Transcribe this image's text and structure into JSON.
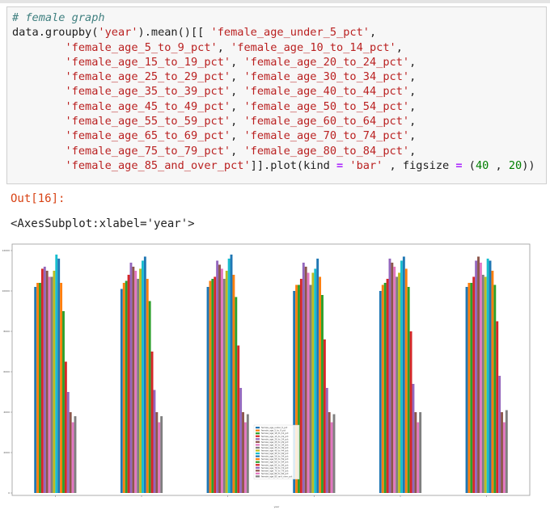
{
  "code_cell": {
    "lines": [
      [
        {
          "t": "# female graph",
          "c": "c-comment"
        }
      ],
      [
        {
          "t": "data.groupby("
        },
        {
          "t": "'year'",
          "c": "c-str"
        },
        {
          "t": ").mean()[[ "
        },
        {
          "t": "'female_age_under_5_pct'",
          "c": "c-str"
        },
        {
          "t": ","
        }
      ],
      [
        {
          "t": "        "
        },
        {
          "t": "'female_age_5_to_9_pct'",
          "c": "c-str"
        },
        {
          "t": ", "
        },
        {
          "t": "'female_age_10_to_14_pct'",
          "c": "c-str"
        },
        {
          "t": ","
        }
      ],
      [
        {
          "t": "        "
        },
        {
          "t": "'female_age_15_to_19_pct'",
          "c": "c-str"
        },
        {
          "t": ", "
        },
        {
          "t": "'female_age_20_to_24_pct'",
          "c": "c-str"
        },
        {
          "t": ","
        }
      ],
      [
        {
          "t": "        "
        },
        {
          "t": "'female_age_25_to_29_pct'",
          "c": "c-str"
        },
        {
          "t": ", "
        },
        {
          "t": "'female_age_30_to_34_pct'",
          "c": "c-str"
        },
        {
          "t": ","
        }
      ],
      [
        {
          "t": "        "
        },
        {
          "t": "'female_age_35_to_39_pct'",
          "c": "c-str"
        },
        {
          "t": ", "
        },
        {
          "t": "'female_age_40_to_44_pct'",
          "c": "c-str"
        },
        {
          "t": ","
        }
      ],
      [
        {
          "t": "        "
        },
        {
          "t": "'female_age_45_to_49_pct'",
          "c": "c-str"
        },
        {
          "t": ", "
        },
        {
          "t": "'female_age_50_to_54_pct'",
          "c": "c-str"
        },
        {
          "t": ","
        }
      ],
      [
        {
          "t": "        "
        },
        {
          "t": "'female_age_55_to_59_pct'",
          "c": "c-str"
        },
        {
          "t": ", "
        },
        {
          "t": "'female_age_60_to_64_pct'",
          "c": "c-str"
        },
        {
          "t": ","
        }
      ],
      [
        {
          "t": "        "
        },
        {
          "t": "'female_age_65_to_69_pct'",
          "c": "c-str"
        },
        {
          "t": ", "
        },
        {
          "t": "'female_age_70_to_74_pct'",
          "c": "c-str"
        },
        {
          "t": ","
        }
      ],
      [
        {
          "t": "        "
        },
        {
          "t": "'female_age_75_to_79_pct'",
          "c": "c-str"
        },
        {
          "t": ", "
        },
        {
          "t": "'female_age_80_to_84_pct'",
          "c": "c-str"
        },
        {
          "t": ","
        }
      ],
      [
        {
          "t": "        "
        },
        {
          "t": "'female_age_85_and_over_pct'",
          "c": "c-str"
        },
        {
          "t": "]].plot(kind "
        },
        {
          "t": "=",
          "c": "c-op"
        },
        {
          "t": " "
        },
        {
          "t": "'bar'",
          "c": "c-str"
        },
        {
          "t": " , figsize "
        },
        {
          "t": "=",
          "c": "c-op"
        },
        {
          "t": " ("
        },
        {
          "t": "40",
          "c": "c-num"
        },
        {
          "t": " , "
        },
        {
          "t": "20",
          "c": "c-num"
        },
        {
          "t": "))"
        }
      ]
    ]
  },
  "output": {
    "prompt": "Out[16]:",
    "repr": "<AxesSubplot:xlabel='year'>"
  },
  "chart_data": {
    "type": "bar",
    "xlabel": "year",
    "ylabel": "",
    "ylim": [
      0,
      12000
    ],
    "yticks": [
      0,
      2000,
      4000,
      6000,
      8000,
      10000,
      12000
    ],
    "categories": [
      "",
      "",
      "",
      "",
      "",
      ""
    ],
    "legend_location": "center",
    "series": [
      {
        "name": "female_age_under_5_pct",
        "color": "#1f77b4",
        "values": [
          10200,
          10100,
          10200,
          10000,
          10000,
          10200
        ]
      },
      {
        "name": "female_age_5_to_9_pct",
        "color": "#ff7f0e",
        "values": [
          10400,
          10400,
          10500,
          10300,
          10300,
          10400
        ]
      },
      {
        "name": "female_age_10_to_14_pct",
        "color": "#2ca02c",
        "values": [
          10400,
          10500,
          10600,
          10300,
          10400,
          10400
        ]
      },
      {
        "name": "female_age_15_to_19_pct",
        "color": "#d62728",
        "values": [
          11100,
          10800,
          10700,
          10600,
          10600,
          10700
        ]
      },
      {
        "name": "female_age_20_to_24_pct",
        "color": "#9467bd",
        "values": [
          11200,
          11400,
          11500,
          11400,
          11600,
          11500
        ]
      },
      {
        "name": "female_age_25_to_29_pct",
        "color": "#8c564b",
        "values": [
          11000,
          11200,
          11300,
          11200,
          11400,
          11700
        ]
      },
      {
        "name": "female_age_30_to_34_pct",
        "color": "#e377c2",
        "values": [
          10700,
          11000,
          11100,
          10900,
          11200,
          11400
        ]
      },
      {
        "name": "female_age_35_to_39_pct",
        "color": "#7f7f7f",
        "values": [
          10700,
          10600,
          10600,
          10300,
          10700,
          10800
        ]
      },
      {
        "name": "female_age_40_to_44_pct",
        "color": "#bcbd22",
        "values": [
          11000,
          11100,
          11000,
          10900,
          10900,
          10700
        ]
      },
      {
        "name": "female_age_45_to_49_pct",
        "color": "#17becf",
        "values": [
          11800,
          11500,
          11600,
          11100,
          11500,
          11600
        ]
      },
      {
        "name": "female_age_50_to_54_pct",
        "color": "#1f77b4",
        "values": [
          11600,
          11700,
          11800,
          11600,
          11700,
          11500
        ]
      },
      {
        "name": "female_age_55_to_59_pct",
        "color": "#ff7f0e",
        "values": [
          10400,
          10600,
          10800,
          10700,
          11100,
          11000
        ]
      },
      {
        "name": "female_age_60_to_64_pct",
        "color": "#2ca02c",
        "values": [
          9000,
          9500,
          9700,
          9800,
          10200,
          10300
        ]
      },
      {
        "name": "female_age_65_to_69_pct",
        "color": "#d62728",
        "values": [
          6500,
          7000,
          7300,
          7600,
          8000,
          8500
        ]
      },
      {
        "name": "female_age_70_to_74_pct",
        "color": "#9467bd",
        "values": [
          5000,
          5100,
          5200,
          5200,
          5400,
          5800
        ]
      },
      {
        "name": "female_age_75_to_79_pct",
        "color": "#8c564b",
        "values": [
          4000,
          4000,
          4000,
          4000,
          4000,
          4000
        ]
      },
      {
        "name": "female_age_80_to_84_pct",
        "color": "#e377c2",
        "values": [
          3500,
          3500,
          3500,
          3500,
          3500,
          3500
        ]
      },
      {
        "name": "female_age_85_and_over_pct",
        "color": "#7f7f7f",
        "values": [
          3800,
          3800,
          3900,
          3900,
          4000,
          4100
        ]
      }
    ]
  }
}
